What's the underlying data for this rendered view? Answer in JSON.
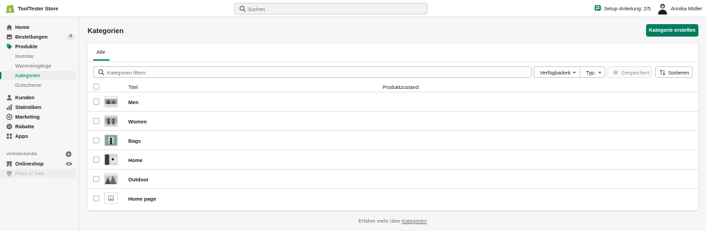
{
  "topbar": {
    "store_name": "ToolTester Store",
    "search_placeholder": "Suchen",
    "setup_label": "Setup-Anleitung: 2/5",
    "user_name": "Annika Müller"
  },
  "sidebar": {
    "items": [
      {
        "label": "Home",
        "icon": "home-icon"
      },
      {
        "label": "Bestellungen",
        "icon": "orders-icon",
        "badge": "4"
      },
      {
        "label": "Produkte",
        "icon": "tag-icon"
      },
      {
        "label": "Inventar"
      },
      {
        "label": "Wareneingänge"
      },
      {
        "label": "Kategorien"
      },
      {
        "label": "Gutscheine"
      },
      {
        "label": "Kunden",
        "icon": "person-icon"
      },
      {
        "label": "Statistiken",
        "icon": "chart-icon"
      },
      {
        "label": "Marketing",
        "icon": "marketing-icon"
      },
      {
        "label": "Rabatte",
        "icon": "discount-icon"
      },
      {
        "label": "Apps",
        "icon": "apps-icon"
      }
    ],
    "channels_heading": "Vertriebskanäle",
    "channels": [
      {
        "label": "Onlineshop",
        "icon": "store-icon"
      },
      {
        "label": "Point of Sale",
        "icon": "pos-icon"
      }
    ]
  },
  "main": {
    "title": "Kategorien",
    "create_button": "Kategorie erstellen",
    "tabs": [
      {
        "label": "Alle"
      }
    ],
    "filter_placeholder": "Kategorien filtern",
    "availability_button": "Verfügbarkeit",
    "type_button": "Typ",
    "saved_button": "Gespeichert",
    "sort_button": "Sortieren",
    "columns": [
      "Titel",
      "Produktzustand"
    ],
    "rows": [
      {
        "title": "Men"
      },
      {
        "title": "Women"
      },
      {
        "title": "Bags"
      },
      {
        "title": "Home"
      },
      {
        "title": "Outdoor"
      },
      {
        "title": "Home page"
      }
    ]
  },
  "footer": {
    "text": "Erfahre mehr über",
    "link": "Kategorien"
  },
  "colors": {
    "accent": "#008060",
    "background": "#f6f6f7"
  }
}
